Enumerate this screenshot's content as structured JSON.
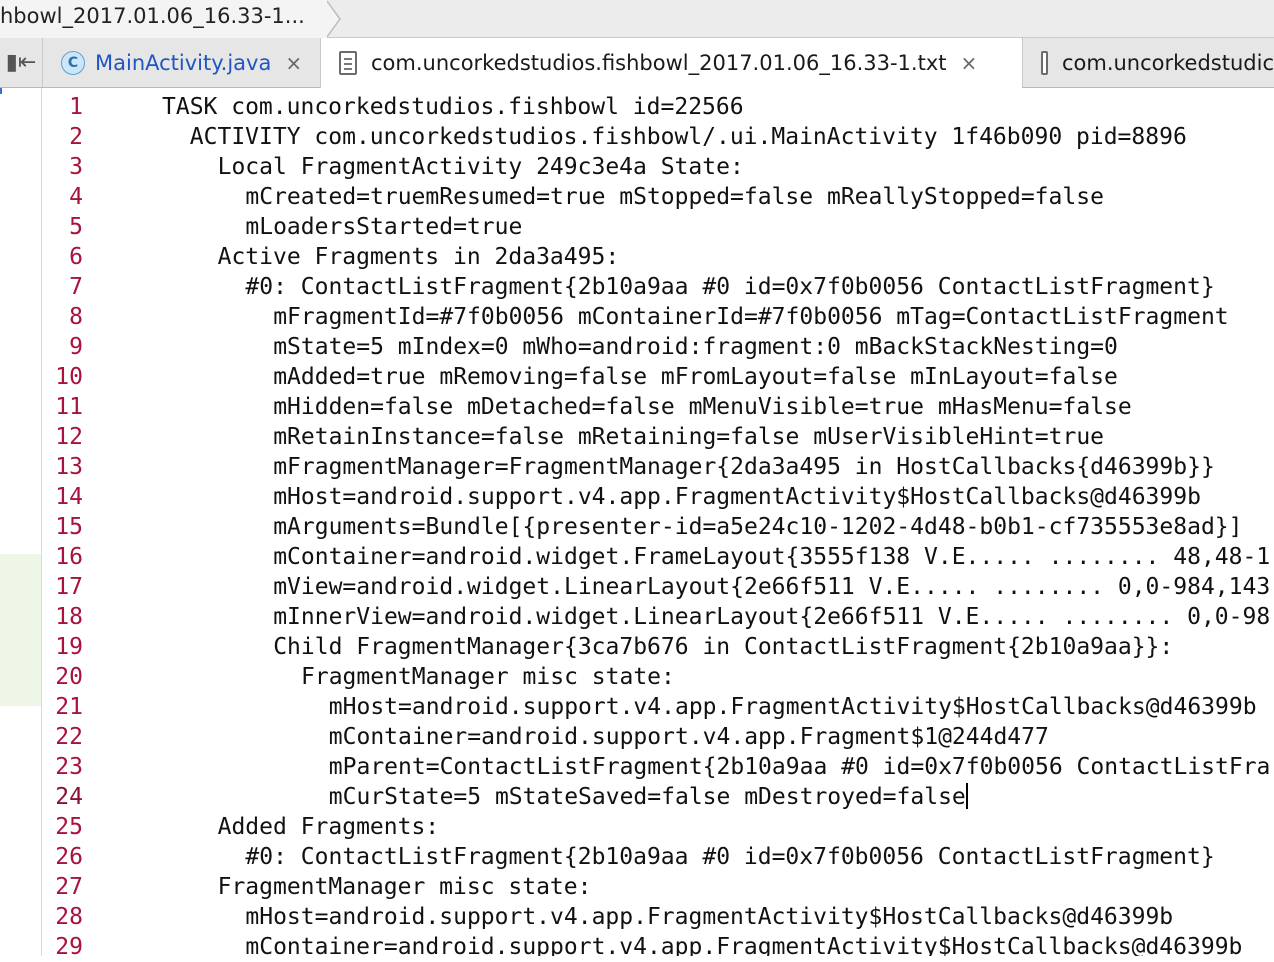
{
  "breadcrumb": {
    "label": "hbowl_2017.01.06_16.33-1..."
  },
  "tabs": [
    {
      "label": "MainActivity.java",
      "close": "×",
      "icon": "java-class-icon",
      "active": false
    },
    {
      "label": "com.uncorkedstudios.fishbowl_2017.01.06_16.33-1.txt",
      "close": "×",
      "icon": "text-file-icon",
      "active": true
    },
    {
      "label": "com.uncorkedstudic",
      "icon": "text-file-icon",
      "active": false
    }
  ],
  "editor": {
    "current_line": 24,
    "lines": [
      {
        "n": "1",
        "indent": 0,
        "text": "TASK com.uncorkedstudios.fishbowl id=22566"
      },
      {
        "n": "2",
        "indent": 1,
        "text": "ACTIVITY com.uncorkedstudios.fishbowl/.ui.MainActivity 1f46b090 pid=8896"
      },
      {
        "n": "3",
        "indent": 2,
        "text": "Local FragmentActivity 249c3e4a State:"
      },
      {
        "n": "4",
        "indent": 3,
        "text": "mCreated=truemResumed=true mStopped=false mReallyStopped=false"
      },
      {
        "n": "5",
        "indent": 3,
        "text": "mLoadersStarted=true"
      },
      {
        "n": "6",
        "indent": 2,
        "text": "Active Fragments in 2da3a495:"
      },
      {
        "n": "7",
        "indent": 3,
        "text": "#0: ContactListFragment{2b10a9aa #0 id=0x7f0b0056 ContactListFragment}"
      },
      {
        "n": "8",
        "indent": 4,
        "text": "mFragmentId=#7f0b0056 mContainerId=#7f0b0056 mTag=ContactListFragment"
      },
      {
        "n": "9",
        "indent": 4,
        "text": "mState=5 mIndex=0 mWho=android:fragment:0 mBackStackNesting=0"
      },
      {
        "n": "10",
        "indent": 4,
        "text": "mAdded=true mRemoving=false mFromLayout=false mInLayout=false"
      },
      {
        "n": "11",
        "indent": 4,
        "text": "mHidden=false mDetached=false mMenuVisible=true mHasMenu=false"
      },
      {
        "n": "12",
        "indent": 4,
        "text": "mRetainInstance=false mRetaining=false mUserVisibleHint=true"
      },
      {
        "n": "13",
        "indent": 4,
        "text": "mFragmentManager=FragmentManager{2da3a495 in HostCallbacks{d46399b}}"
      },
      {
        "n": "14",
        "indent": 4,
        "text": "mHost=android.support.v4.app.FragmentActivity$HostCallbacks@d46399b"
      },
      {
        "n": "15",
        "indent": 4,
        "text": "mArguments=Bundle[{presenter-id=a5e24c10-1202-4d48-b0b1-cf735553e8ad}]"
      },
      {
        "n": "16",
        "indent": 4,
        "text": "mContainer=android.widget.FrameLayout{3555f138 V.E..... ........ 48,48-1"
      },
      {
        "n": "17",
        "indent": 4,
        "text": "mView=android.widget.LinearLayout{2e66f511 V.E..... ........ 0,0-984,143"
      },
      {
        "n": "18",
        "indent": 4,
        "text": "mInnerView=android.widget.LinearLayout{2e66f511 V.E..... ........ 0,0-98"
      },
      {
        "n": "19",
        "indent": 4,
        "text": "Child FragmentManager{3ca7b676 in ContactListFragment{2b10a9aa}}:"
      },
      {
        "n": "20",
        "indent": 5,
        "text": "FragmentManager misc state:"
      },
      {
        "n": "21",
        "indent": 6,
        "text": "mHost=android.support.v4.app.FragmentActivity$HostCallbacks@d46399b"
      },
      {
        "n": "22",
        "indent": 6,
        "text": "mContainer=android.support.v4.app.Fragment$1@244d477"
      },
      {
        "n": "23",
        "indent": 6,
        "text": "mParent=ContactListFragment{2b10a9aa #0 id=0x7f0b0056 ContactListFra"
      },
      {
        "n": "24",
        "indent": 6,
        "text": "mCurState=5 mStateSaved=false mDestroyed=false"
      },
      {
        "n": "25",
        "indent": 2,
        "text": "Added Fragments:"
      },
      {
        "n": "26",
        "indent": 3,
        "text": "#0: ContactListFragment{2b10a9aa #0 id=0x7f0b0056 ContactListFragment}"
      },
      {
        "n": "27",
        "indent": 2,
        "text": "FragmentManager misc state:"
      },
      {
        "n": "28",
        "indent": 3,
        "text": "mHost=android.support.v4.app.FragmentActivity$HostCallbacks@d46399b"
      },
      {
        "n": "29",
        "indent": 3,
        "text": "mContainer=android.support.v4.app.FragmentActivity$HostCallbacks@d46399b"
      }
    ]
  },
  "colors": {
    "line_number": "#a8123c",
    "java_tab_text": "#1f56c4",
    "current_line_bg": "#fdfbe8",
    "change_marker": "#eef7e7"
  },
  "icons": {
    "collapse": "collapse-left-icon",
    "java": "java-class-icon",
    "text": "text-file-icon"
  }
}
